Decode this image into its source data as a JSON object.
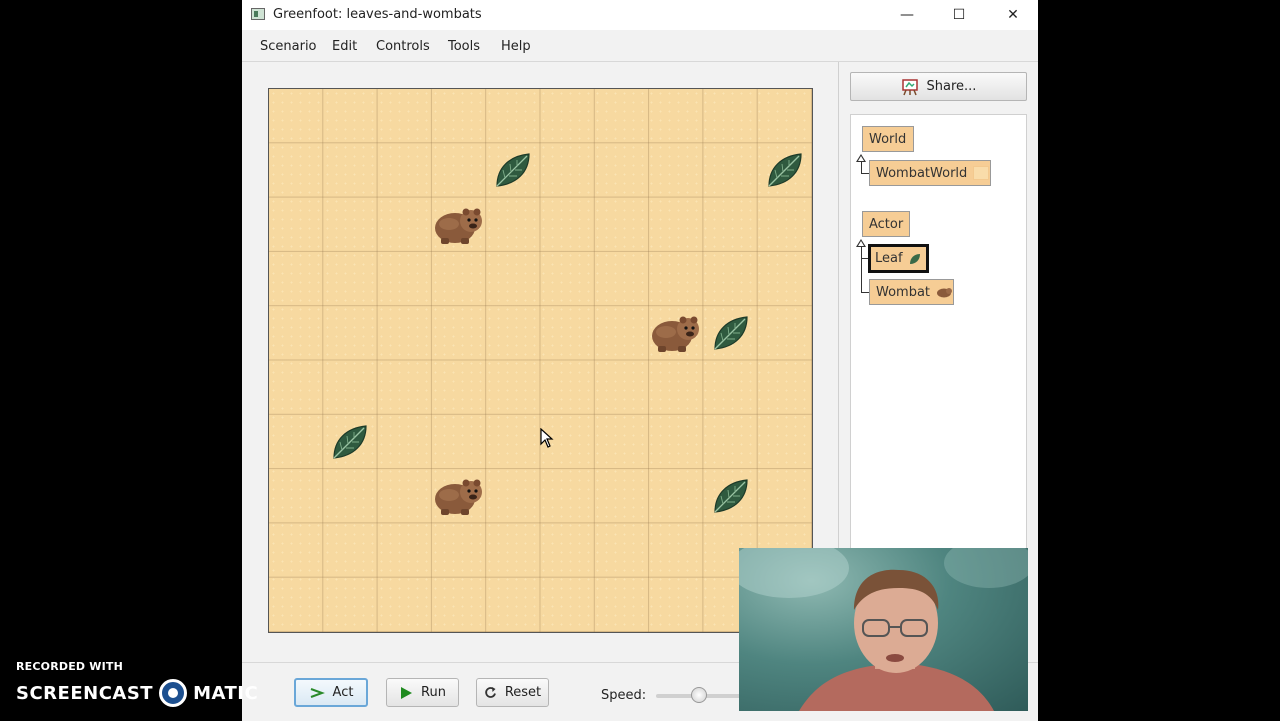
{
  "window": {
    "title": "Greenfoot: leaves-and-wombats",
    "minimize_glyph": "—",
    "maximize_glyph": "☐",
    "close_glyph": "✕"
  },
  "menu": [
    "Scenario",
    "Edit",
    "Controls",
    "Tools",
    "Help"
  ],
  "world": {
    "columns": 10,
    "rows": 10,
    "actors": [
      {
        "type": "leaf",
        "col": 4,
        "row": 1
      },
      {
        "type": "leaf",
        "col": 9,
        "row": 1
      },
      {
        "type": "wombat",
        "col": 3,
        "row": 2
      },
      {
        "type": "wombat",
        "col": 7,
        "row": 4
      },
      {
        "type": "leaf",
        "col": 8,
        "row": 4
      },
      {
        "type": "leaf",
        "col": 1,
        "row": 6
      },
      {
        "type": "wombat",
        "col": 3,
        "row": 7
      },
      {
        "type": "leaf",
        "col": 8,
        "row": 7
      }
    ]
  },
  "controls": {
    "act_label": "Act",
    "run_label": "Run",
    "reset_label": "Reset",
    "speed_label": "Speed:",
    "speed_fraction": 0.5
  },
  "sidebar": {
    "share_label": "Share...",
    "classes": {
      "world": "World",
      "wombat_world": "WombatWorld",
      "actor": "Actor",
      "leaf": "Leaf",
      "wombat": "Wombat"
    }
  },
  "watermark": {
    "line1": "RECORDED WITH",
    "brand_left": "SCREENCAST",
    "brand_right": "MATIC"
  },
  "colors": {
    "class_box": "#f6cd95",
    "world_bg": "#f7d9a0",
    "leaf": "#2f5a3f",
    "wombat": "#8a5a3b"
  }
}
